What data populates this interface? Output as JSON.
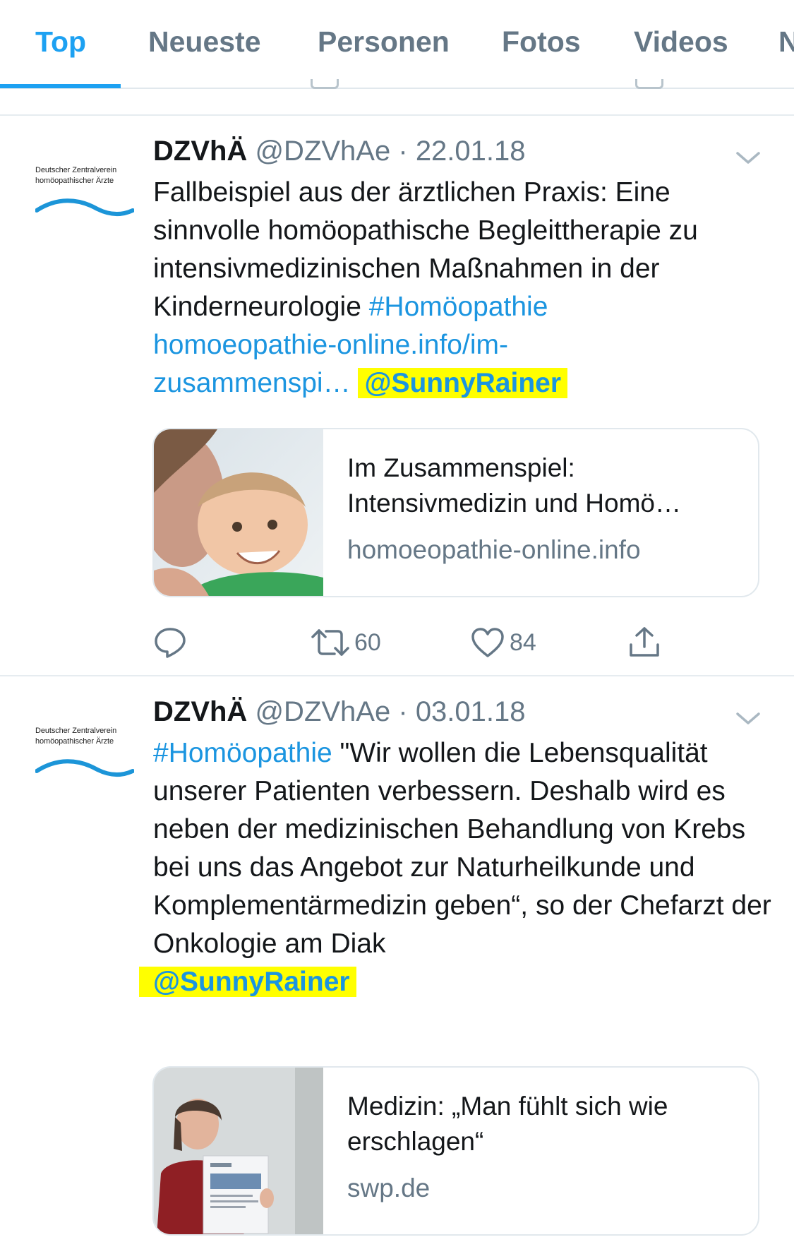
{
  "tabs": [
    {
      "label": "Top",
      "active": true
    },
    {
      "label": "Neueste",
      "active": false
    },
    {
      "label": "Personen",
      "active": false
    },
    {
      "label": "Fotos",
      "active": false
    },
    {
      "label": "Videos",
      "active": false
    },
    {
      "label": "N",
      "active": false
    }
  ],
  "colors": {
    "accent": "#1da1f2",
    "link": "#1b95e0",
    "highlight": "#ffff00",
    "muted": "#657786"
  },
  "avatar": {
    "org_line1": "Deutscher Zentralverein",
    "org_line2": "homöopathischer Ärzte"
  },
  "tweets": [
    {
      "name": "DZVhÄ",
      "handle": "@DZVhAe",
      "sep": "·",
      "date": "22.01.18",
      "text_part1": "Fallbeispiel aus der ärztlichen Praxis: Eine sinnvolle homöopathische  Begleittherapie zu intensivmedizinischen Maßnahmen in der  Kinderneurologie ",
      "hashtag": "#Homöopathie",
      "url_line1": "homoeopathie-online.info/im-",
      "url_line2": "zusammenspi…",
      "mention": "@SunnyRainer",
      "card": {
        "title_line1": "Im Zusammenspiel:",
        "title_line2": "Intensivmedizin und Homö…",
        "domain": "homoeopathie-online.info",
        "image": "woman-and-child-photo"
      },
      "actions": {
        "reply_icon": "reply-icon",
        "retweet_icon": "retweet-icon",
        "retweets": "60",
        "like_icon": "heart-icon",
        "likes": "84",
        "share_icon": "share-icon"
      }
    },
    {
      "name": "DZVhÄ",
      "handle": "@DZVhAe",
      "sep": "·",
      "date": "03.01.18",
      "hashtag": "#Homöopathie",
      "text_after_hashtag": " \"Wir wollen die Lebensqualität unserer Patienten verbessern. Deshalb wird es neben der medizinischen Behandlung von Krebs bei uns das Angebot zur Naturheilkunde und Komplementärmedizin geben“, so der Chefarzt der Onkologie am Diak",
      "mention": "@SunnyRainer",
      "card": {
        "title_line1": "Medizin: „Man fühlt sich wie",
        "title_line2": "erschlagen“",
        "domain": "swp.de",
        "image": "woman-holding-document-photo"
      }
    }
  ]
}
